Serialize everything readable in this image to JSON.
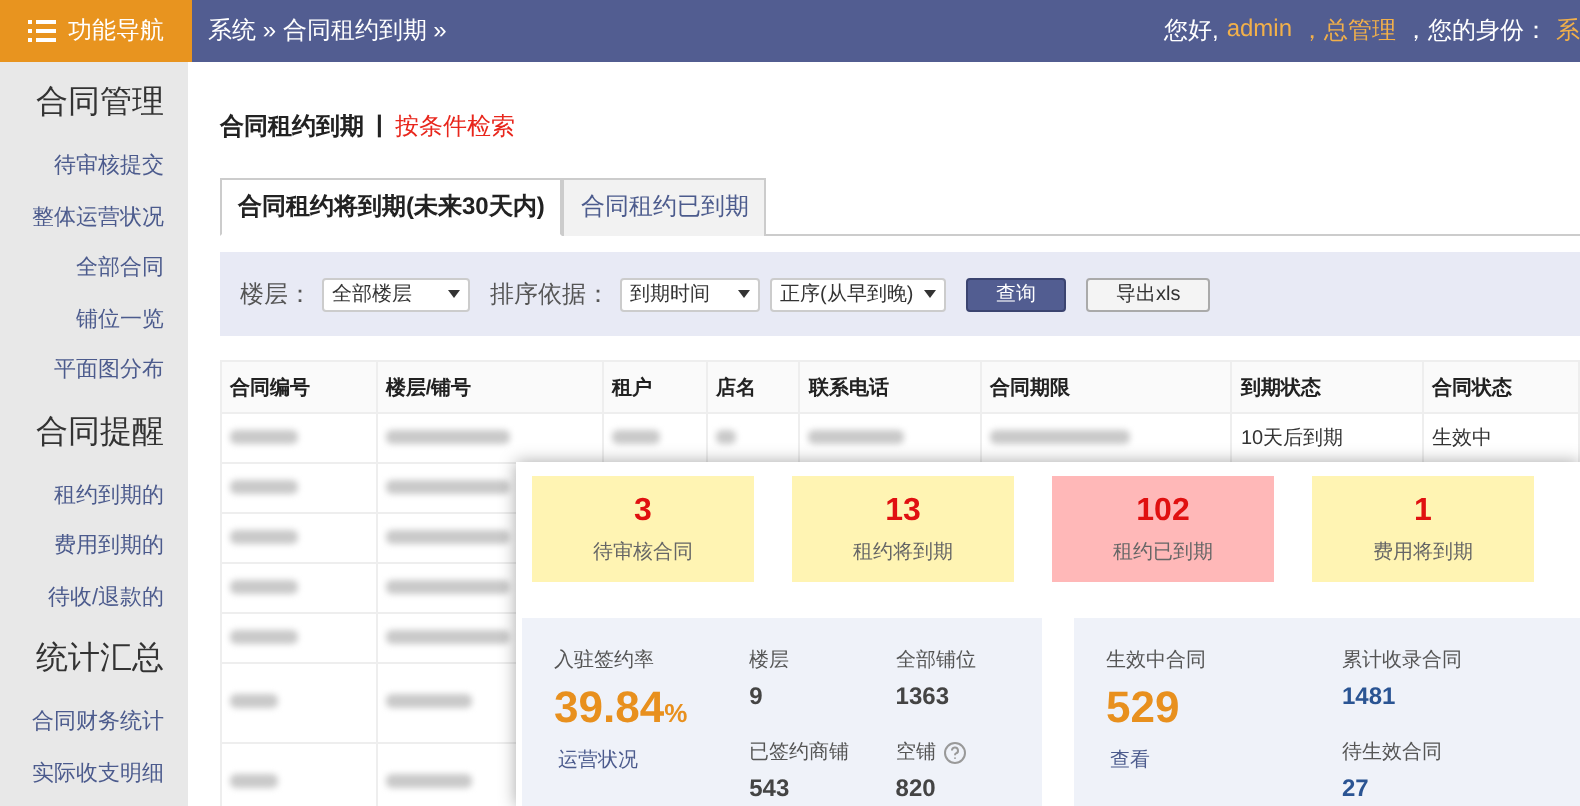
{
  "topbar": {
    "nav_button": "功能导航",
    "breadcrumb": "系统 » 合同租约到期 »",
    "greeting": "您好,",
    "user": "admin",
    "role": "，总管理",
    "identity_label": "，您的身份：",
    "identity_value": "系"
  },
  "sidebar": [
    {
      "heading": "合同管理",
      "items": [
        "待审核提交",
        "整体运营状况",
        "全部合同",
        "铺位一览",
        "平面图分布"
      ]
    },
    {
      "heading": "合同提醒",
      "items": [
        "租约到期的",
        "费用到期的",
        "待收/退款的"
      ]
    },
    {
      "heading": "统计汇总",
      "items": [
        "合同财务统计",
        "实际收支明细"
      ]
    }
  ],
  "page_title": "合同租约到期",
  "separator": "|",
  "search_link": "按条件检索",
  "tabs": [
    {
      "label": "合同租约将到期(未来30天内)",
      "selected": true
    },
    {
      "label": "合同租约已到期",
      "selected": false
    }
  ],
  "filters": {
    "floor_label": "楼层：",
    "floor_value": "全部楼层",
    "sort_label": "排序依据：",
    "sort_value": "到期时间",
    "order_value": "正序(从早到晚)",
    "query_button": "查询",
    "export_button": "导出xls"
  },
  "table": {
    "columns": [
      "合同编号",
      "楼层/铺号",
      "租户",
      "店名",
      "联系电话",
      "合同期限",
      "到期状态",
      "合同状态"
    ],
    "rows": [
      {
        "tall": false,
        "expiry_status": "10天后到期",
        "contract_status": "生效中"
      },
      {
        "tall": false
      },
      {
        "tall": false
      },
      {
        "tall": false
      },
      {
        "tall": false
      },
      {
        "tall": true
      },
      {
        "tall": true
      }
    ]
  },
  "stat_cards": [
    {
      "value": "3",
      "label": "待审核合同",
      "color": "#fff4b3"
    },
    {
      "value": "13",
      "label": "租约将到期",
      "color": "#fff4b3"
    },
    {
      "value": "102",
      "label": "租约已到期",
      "color": "#ffb8b8"
    },
    {
      "value": "1",
      "label": "费用将到期",
      "color": "#fff4b3"
    }
  ],
  "occupancy": {
    "label": "入驻签约率",
    "value": "39.84",
    "unit": "%",
    "link": "运营状况",
    "stats": [
      {
        "label": "楼层",
        "value": "9",
        "help": false
      },
      {
        "label": "全部铺位",
        "value": "1363",
        "help": false
      },
      {
        "label": "已签约商铺",
        "value": "543",
        "help": false
      },
      {
        "label": "空铺",
        "value": "820",
        "help": true
      }
    ]
  },
  "contracts": {
    "label": "生效中合同",
    "value": "529",
    "link": "查看",
    "stats": [
      {
        "label": "累计收录合同",
        "value": "1481"
      },
      {
        "label": "待生效合同",
        "value": "27"
      }
    ]
  }
}
